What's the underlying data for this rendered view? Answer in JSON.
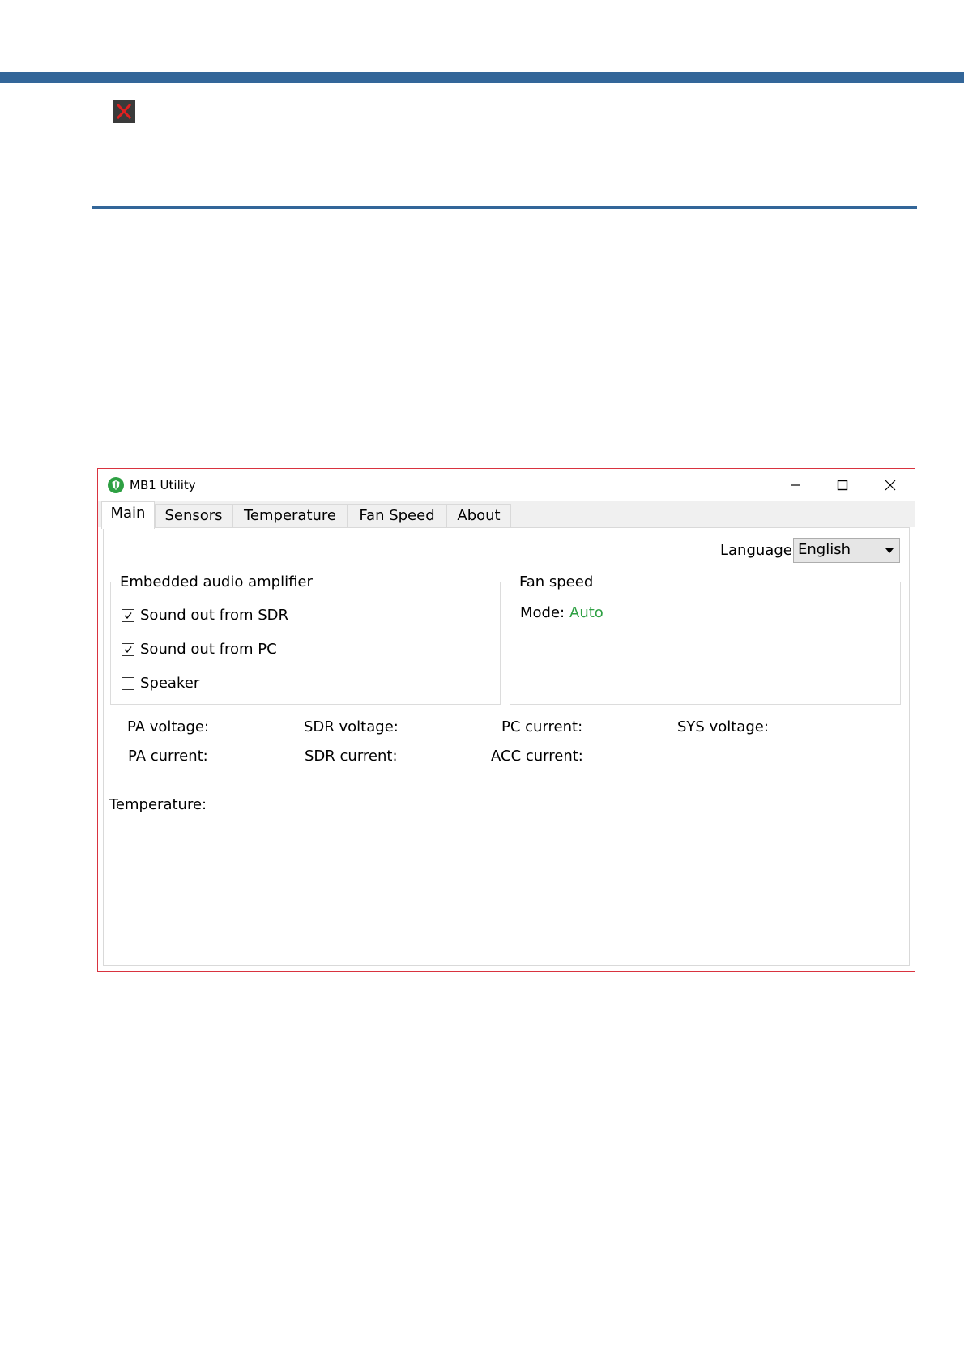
{
  "window": {
    "title": "MB1 Utility",
    "accent_border": "#d9333f",
    "header_band_color": "#336699"
  },
  "tabs": [
    "Main",
    "Sensors",
    "Temperature",
    "Fan Speed",
    "About"
  ],
  "active_tab": "Main",
  "language": {
    "label": "Language:",
    "value": "English"
  },
  "audio_group": {
    "title": "Embedded audio amplifier",
    "options": [
      {
        "label": "Sound out from SDR",
        "checked": true
      },
      {
        "label": "Sound out from PC",
        "checked": true
      },
      {
        "label": "Speaker",
        "checked": false
      }
    ]
  },
  "fan_group": {
    "title": "Fan speed",
    "mode_label": "Mode:",
    "mode_value": "Auto",
    "mode_color": "#2ea043"
  },
  "readouts": {
    "pa_voltage": "PA voltage:",
    "sdr_voltage": "SDR voltage:",
    "pc_current": "PC current:",
    "sys_voltage": "SYS voltage:",
    "pa_current": "PA current:",
    "sdr_current": "SDR current:",
    "acc_current": "ACC current:"
  },
  "temperature_label": "Temperature:"
}
